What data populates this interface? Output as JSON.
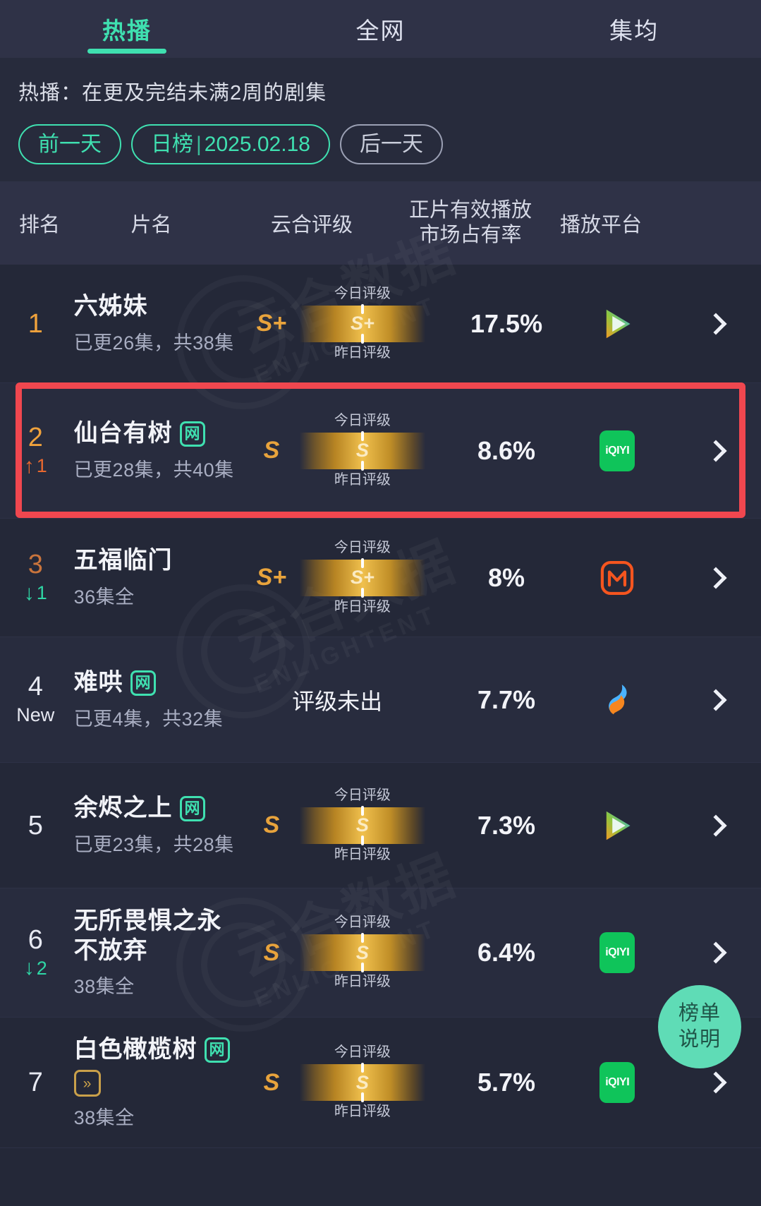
{
  "tabs": [
    {
      "label": "热播",
      "active": true
    },
    {
      "label": "全网",
      "active": false
    },
    {
      "label": "集均",
      "active": false
    }
  ],
  "filter": {
    "description": "热播：在更及完结未满2周的剧集",
    "prev_day": "前一天",
    "ranking_label": "日榜",
    "separator": "|",
    "date": "2025.02.18",
    "next_day": "后一天"
  },
  "table": {
    "headers": {
      "rank": "排名",
      "title": "片名",
      "grade": "云合评级",
      "share_line1": "正片有效播放",
      "share_line2": "市场占有率",
      "platform": "播放平台"
    },
    "wheel_labels": {
      "today": "今日评级",
      "yesterday": "昨日评级"
    },
    "no_grade_text": "评级未出",
    "rows": [
      {
        "rank": "1",
        "rank_color": "gold",
        "change_type": "none",
        "change_value": "",
        "title": "六姊妹",
        "badges": [],
        "episodes": "已更26集，共38集",
        "grade_left": "S+",
        "grade_today": "S+",
        "grade_yesterday": "S+",
        "share": "17.5%",
        "platform": "tencent-video"
      },
      {
        "rank": "2",
        "rank_color": "gold",
        "change_type": "up",
        "change_value": "1",
        "title": "仙台有树",
        "badges": [
          "net"
        ],
        "episodes": "已更28集，共40集",
        "grade_left": "S",
        "grade_today": "S",
        "grade_yesterday": "S",
        "share": "8.6%",
        "platform": "iqiyi",
        "highlighted": true
      },
      {
        "rank": "3",
        "rank_color": "bronze",
        "change_type": "down",
        "change_value": "1",
        "title": "五福临门",
        "badges": [],
        "episodes": "36集全",
        "grade_left": "S+",
        "grade_today": "S+",
        "grade_yesterday": "S+",
        "share": "8%",
        "platform": "mango-tv"
      },
      {
        "rank": "4",
        "rank_color": "white",
        "change_type": "new",
        "change_value": "New",
        "title": "难哄",
        "badges": [
          "net"
        ],
        "episodes": "已更4集，共32集",
        "grade_left": "",
        "grade_today": "",
        "grade_yesterday": "",
        "share": "7.7%",
        "platform": "youku"
      },
      {
        "rank": "5",
        "rank_color": "white",
        "change_type": "none",
        "change_value": "",
        "title": "余烬之上",
        "badges": [
          "net"
        ],
        "episodes": "已更23集，共28集",
        "grade_left": "S",
        "grade_today": "S",
        "grade_yesterday": "S",
        "share": "7.3%",
        "platform": "tencent-video"
      },
      {
        "rank": "6",
        "rank_color": "white",
        "change_type": "down",
        "change_value": "2",
        "title": "无所畏惧之永不放弃",
        "badges": [],
        "episodes": "38集全",
        "grade_left": "S",
        "grade_today": "S",
        "grade_yesterday": "S",
        "share": "6.4%",
        "platform": "iqiyi"
      },
      {
        "rank": "7",
        "rank_color": "white",
        "change_type": "none",
        "change_value": "",
        "title": "白色橄榄树",
        "badges": [
          "net",
          "fastforward"
        ],
        "episodes": "38集全",
        "grade_left": "S",
        "grade_today": "S",
        "grade_yesterday": "S",
        "share": "5.7%",
        "platform": "iqiyi"
      }
    ]
  },
  "badges": {
    "net": "网",
    "fastforward": "»"
  },
  "fab": {
    "line1": "榜单",
    "line2": "说明"
  },
  "watermark": {
    "cn": "云合数据",
    "en": "ENLIGHTENT"
  },
  "colors": {
    "accent_green": "#3fe0b0",
    "highlight_red": "#f0474f",
    "gold": "#f0a23c",
    "bg": "#242838",
    "row_alt": "#282c3e",
    "header_bg": "#2f3247"
  }
}
